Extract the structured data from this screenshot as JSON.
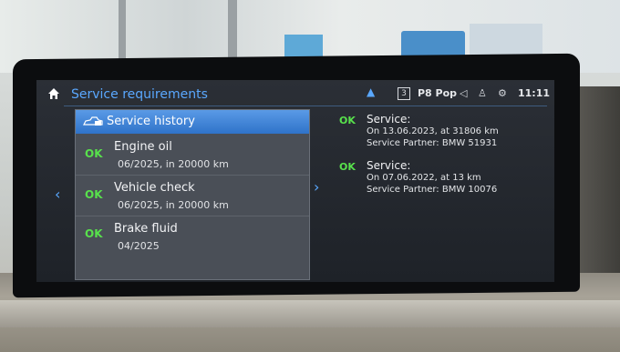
{
  "header": {
    "title": "Service requirements",
    "preset_number": "3",
    "station": "P8 Pop",
    "time": "11:11",
    "icons": [
      "home-icon",
      "chevron-up-icon",
      "mute-icon",
      "connection-icon",
      "settings-icon"
    ]
  },
  "list": {
    "history_label": "Service history",
    "items": [
      {
        "status": "OK",
        "name": "Engine oil",
        "detail": "06/2025, in 20000 km"
      },
      {
        "status": "OK",
        "name": "Vehicle check",
        "detail": "06/2025, in 20000 km"
      },
      {
        "status": "OK",
        "name": "Brake fluid",
        "detail": "04/2025"
      }
    ]
  },
  "history": [
    {
      "status": "OK",
      "title": "Service:",
      "date_line": "On 13.06.2023, at 31806 km",
      "partner_line": "Service Partner: BMW 51931"
    },
    {
      "status": "OK",
      "title": "Service:",
      "date_line": "On 07.06.2022, at 13 km",
      "partner_line": "Service Partner: BMW 10076"
    }
  ],
  "colors": {
    "accent": "#5aa8ff",
    "ok": "#58e14c",
    "selection": "#2f73c9"
  }
}
